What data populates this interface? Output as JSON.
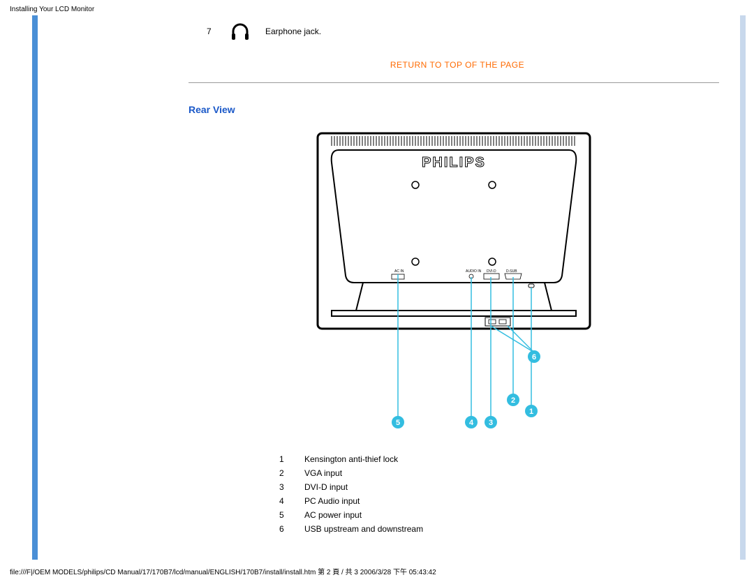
{
  "header": "Installing Your LCD Monitor",
  "front_item": {
    "num": "7",
    "label": "Earphone jack."
  },
  "return_link": "RETURN TO TOP OF THE PAGE",
  "section_heading": "Rear View",
  "brand": "PHILIPS",
  "port_labels": {
    "ac": "AC IN",
    "audio": "AUDIO IN",
    "dvi": "DVI-D",
    "vga": "D-SUB"
  },
  "callouts": [
    "1",
    "2",
    "3",
    "4",
    "5",
    "6"
  ],
  "rear_items": [
    {
      "num": "1",
      "label": "Kensington anti-thief lock"
    },
    {
      "num": "2",
      "label": "VGA input"
    },
    {
      "num": "3",
      "label": "DVI-D input"
    },
    {
      "num": "4",
      "label": "PC Audio input"
    },
    {
      "num": "5",
      "label": "AC power input"
    },
    {
      "num": "6",
      "label": "USB upstream and downstream"
    }
  ],
  "footer": "file:///F|/OEM MODELS/philips/CD Manual/17/170B7/lcd/manual/ENGLISH/170B7/install/install.htm 第 2 頁 / 共 3 2006/3/28 下午 05:43:42"
}
